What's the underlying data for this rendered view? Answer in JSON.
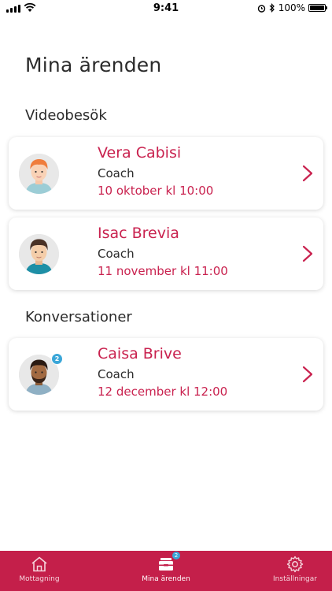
{
  "status_bar": {
    "time": "9:41",
    "battery": "100%"
  },
  "page_title": "Mina ärenden",
  "sections": [
    {
      "title": "Videobesök",
      "items": [
        {
          "name": "Vera Cabisi",
          "role": "Coach",
          "date": "10 oktober kl 10:00",
          "avatar": "avatar-redhead-man-icon"
        },
        {
          "name": "Isac Brevia",
          "role": "Coach",
          "date": "11 november kl 11:00",
          "avatar": "avatar-dark-hair-man-icon"
        }
      ]
    },
    {
      "title": "Konversationer",
      "items": [
        {
          "name": "Caisa Brive",
          "role": "Coach",
          "date": "12 december kl 12:00",
          "avatar": "avatar-bearded-man-icon",
          "badge": "2"
        }
      ]
    }
  ],
  "tab_bar": {
    "tabs": [
      {
        "label": "Mottagning",
        "icon": "house-icon"
      },
      {
        "label": "Mina ärenden",
        "icon": "inbox-icon",
        "badge": "2",
        "active": true
      },
      {
        "label": "Inställningar",
        "icon": "gear-icon"
      }
    ]
  },
  "colors": {
    "accent": "#c9224f",
    "tab_bar": "#c41f4a",
    "badge": "#3aa6d8"
  }
}
